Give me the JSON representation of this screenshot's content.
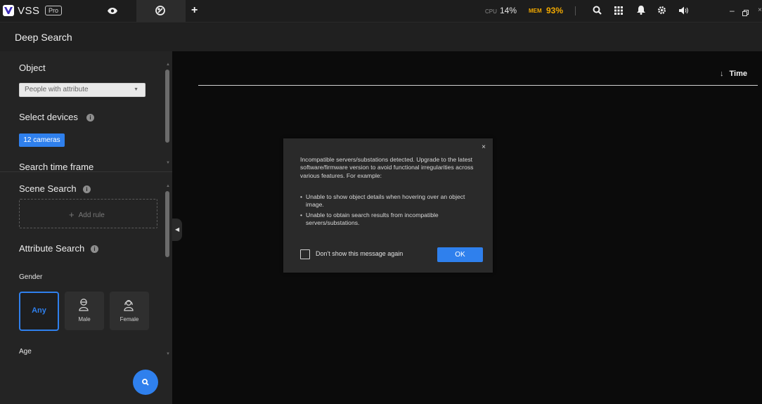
{
  "topbar": {
    "brand": "VSS",
    "badge": "Pro",
    "tabs": [
      {
        "icon": "eye-icon"
      },
      {
        "icon": "deep-search-icon",
        "active": true
      },
      {
        "label": "+"
      }
    ],
    "cpu_label": "CPU",
    "cpu_value": "14%",
    "mem_label": "MEM",
    "mem_value": "93%",
    "mem_color": "#f2a900",
    "icons": [
      "search-icon",
      "grid-icon",
      "bell-icon",
      "gear-icon",
      "speaker-icon"
    ],
    "window": {
      "minimize": "–",
      "close": "×"
    }
  },
  "page": {
    "title": "Deep Search"
  },
  "sidebar": {
    "object": {
      "title": "Object",
      "selected": "People with attribute"
    },
    "devices": {
      "title": "Select devices",
      "button": "12 cameras"
    },
    "time_frame": {
      "title": "Search time frame"
    },
    "scene": {
      "title": "Scene Search",
      "add_rule": "Add rule",
      "add_symbol": "+"
    },
    "attribute": {
      "title": "Attribute Search"
    },
    "gender": {
      "title": "Gender",
      "options": [
        {
          "label": "Any",
          "selected": true
        },
        {
          "label": "Male"
        },
        {
          "label": "Female"
        }
      ]
    },
    "age": {
      "title": "Age"
    }
  },
  "results": {
    "sort_label": "Time",
    "sort_arrow": "↓"
  },
  "dialog": {
    "message": "Incompatible servers/substations detected. Upgrade to the latest software/firmware version to avoid functional irregularities across various features. For example:",
    "items": [
      "Unable to show object details when hovering over an object image.",
      "Unable to obtain search results from incompatible servers/substations."
    ],
    "checkbox_label": "Don't show this message again",
    "ok_label": "OK",
    "close": "×"
  },
  "accent_color": "#2f80ed"
}
